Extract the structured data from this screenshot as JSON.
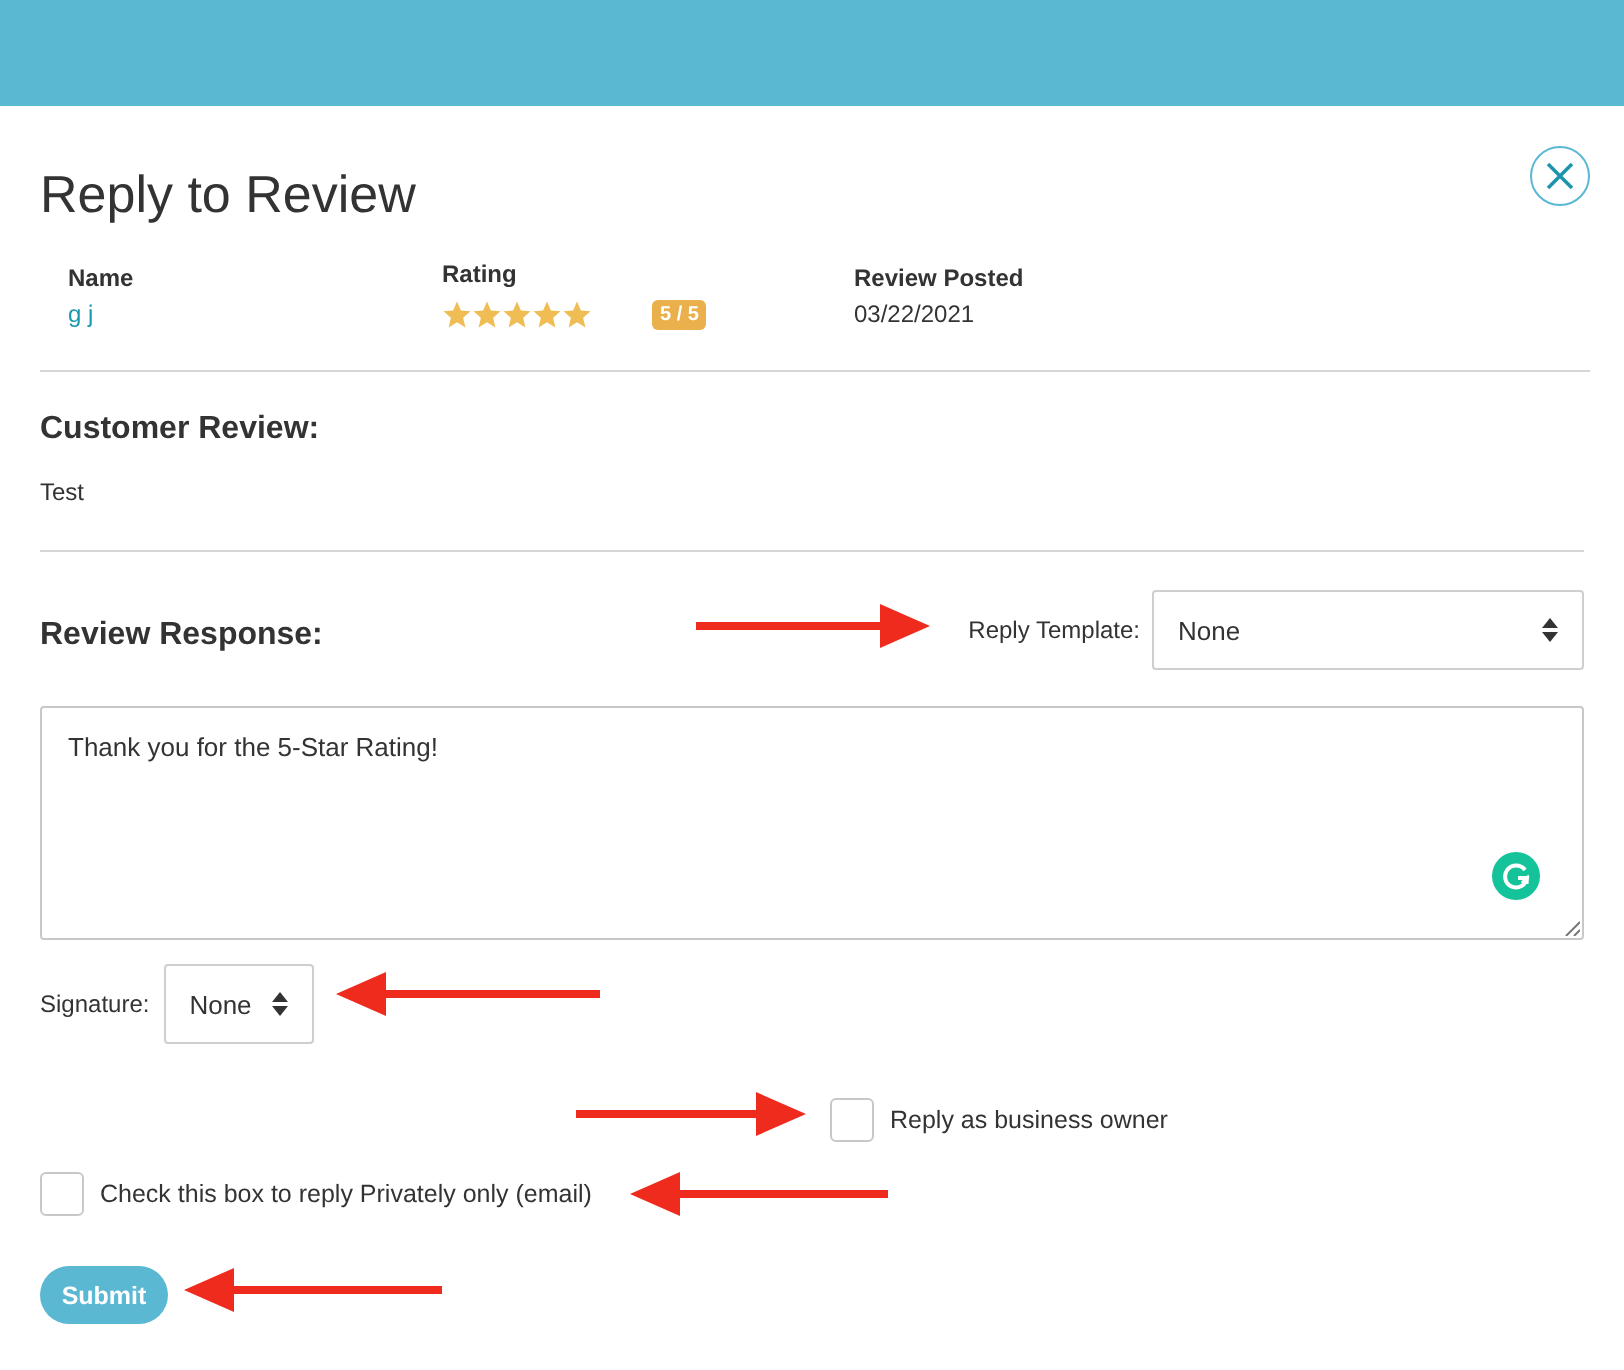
{
  "title": "Reply to Review",
  "review_info": [
    {
      "kind": "link",
      "label": "Name",
      "value": "g j"
    },
    {
      "kind": "rating",
      "label": "Rating",
      "stars": 5,
      "badge": "5 / 5"
    },
    {
      "kind": "text",
      "label": "Review Posted",
      "value": "03/22/2021"
    }
  ],
  "customer_review": {
    "heading": "Customer Review:",
    "text": "Test"
  },
  "review_response": {
    "heading": "Review Response:",
    "template_label": "Reply Template:",
    "template_value": "None",
    "response_text": "Thank you for the 5-Star Rating!"
  },
  "signature": {
    "label": "Signature:",
    "value": "None"
  },
  "options": [
    {
      "label": "Reply as business owner",
      "checked": false
    },
    {
      "label": "Check this box to reply Privately only (email)",
      "checked": false
    }
  ],
  "submit": "Submit"
}
